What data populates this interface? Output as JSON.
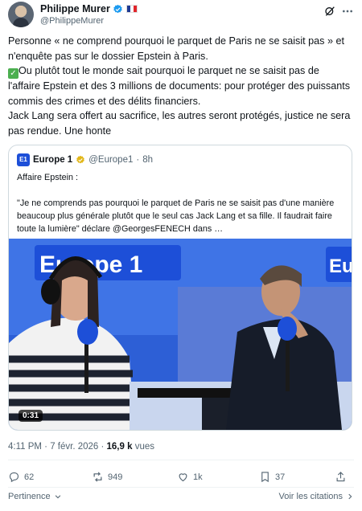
{
  "author": {
    "name": "Philippe Murer",
    "handle": "@PhilippeMurer"
  },
  "tweet": {
    "paragraph1": "Personne « ne comprend pourquoi le parquet de Paris ne se saisit pas » et n'enquête pas sur le dossier Epstein à Paris.",
    "paragraph2": "Ou plutôt tout le monde sait pourquoi le parquet ne se saisit pas de l'affaire Epstein et des 3 millions de documents: pour protéger des puissants commis des crimes et des délits financiers.",
    "paragraph3": "Jack Lang sera offert au sacrifice, les autres seront protégés, justice ne sera pas rendue. Une honte"
  },
  "quote": {
    "logo_text": "E1",
    "name": "Europe 1",
    "handle": "@Europe1",
    "separator": "·",
    "time": "8h",
    "text": "Affaire Epstein :\n\n\"Je ne comprends pas pourquoi le parquet de Paris ne se saisit pas d'une manière beaucoup plus générale plutôt que le seul cas Jack Lang et sa fille. Il faudrait faire toute la lumière\" déclare @GeorgesFENECH dans …",
    "media": {
      "duration": "0:31",
      "studio_sign_left": "Europe 1",
      "studio_sign_right": "Euro"
    }
  },
  "meta": {
    "time": "4:11 PM · 7 févr. 2026 · ",
    "views_count": "16,9 k",
    "views_label": " vues"
  },
  "actions": {
    "replies": "62",
    "reposts": "949",
    "likes": "1k",
    "bookmarks": "37"
  },
  "footer": {
    "relevance": "Pertinence",
    "quotes_link": "Voir les citations"
  },
  "colors": {
    "verified": "#1d9bf0",
    "europe1_blue": "#1d4fd8",
    "text_secondary": "#536471"
  }
}
